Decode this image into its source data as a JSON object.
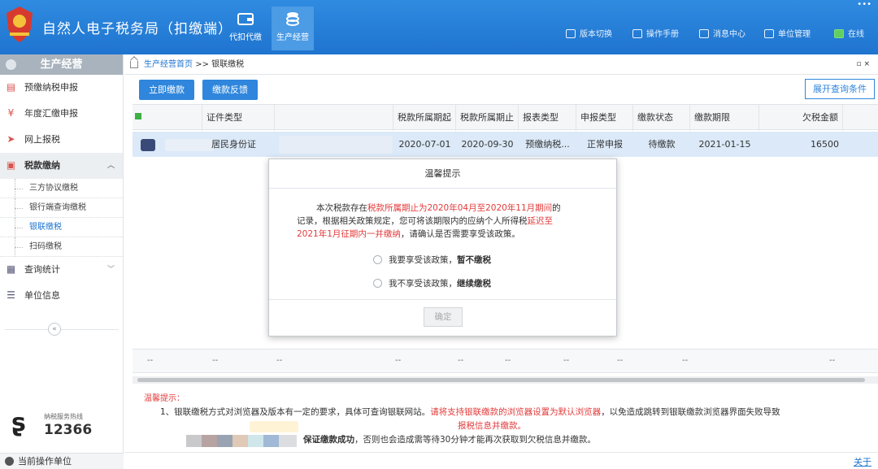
{
  "header": {
    "title": "自然人电子税务局（扣缴端）",
    "nav": [
      {
        "label": "代扣代缴",
        "icon": "wallet-icon"
      },
      {
        "label": "生产经营",
        "icon": "coins-icon"
      }
    ],
    "links": [
      "版本切换",
      "操作手册",
      "消息中心",
      "单位管理",
      "在线"
    ]
  },
  "sidebar": {
    "title": "生产经营",
    "items": [
      {
        "label": "预缴纳税申报",
        "icon": "document-icon"
      },
      {
        "label": "年度汇缴申报",
        "icon": "yen-icon"
      },
      {
        "label": "网上报税",
        "icon": "send-icon"
      },
      {
        "label": "税款缴纳",
        "icon": "tax-icon"
      }
    ],
    "subitems": [
      "三方协议缴税",
      "银行端查询缴税",
      "银联缴税",
      "扫码缴税"
    ],
    "items2": [
      {
        "label": "查询统计",
        "icon": "query-icon"
      },
      {
        "label": "单位信息",
        "icon": "list-icon"
      }
    ],
    "collapse": "«",
    "hotline_label": "纳税服务热线",
    "hotline_number": "12366",
    "footer": "当前操作单位"
  },
  "breadcrumb": {
    "home": "生产经营首页",
    "sep": ">>",
    "current": "银联缴税",
    "close": "▫ ×"
  },
  "toolbar": {
    "pay_now": "立即缴款",
    "feedback": "缴款反馈",
    "expand": "展开查询条件"
  },
  "table": {
    "columns": [
      "证件类型",
      "税款所属期起",
      "税款所属期止",
      "报表类型",
      "申报类型",
      "缴款状态",
      "缴款期限",
      "欠税金额"
    ],
    "row": {
      "id_type": "居民身份证",
      "period_start": "2020-07-01",
      "period_end": "2020-09-30",
      "report_type": "预缴纳税...",
      "declare_type": "正常申报",
      "pay_status": "待缴款",
      "deadline": "2021-01-15",
      "amount": "16500"
    },
    "placeholder": "--"
  },
  "modal": {
    "title": "温馨提示",
    "p1": "本次税款存在",
    "p1_red": "税款所属期止为2020年04月至2020年11月期间",
    "p1_end": "的",
    "p2": "记录，根据相关政策规定，您可将该期限内的应纳个人所得税",
    "p2_red": "延迟至",
    "p3_red": "2021年1月征期内一并缴纳",
    "p3": "，请确认是否需要享受该政策。",
    "opt1": "我要享受该政策，",
    "opt1_bold": "暂不缴税",
    "opt2": "我不享受该政策，",
    "opt2_bold": "继续缴税",
    "confirm": "确定"
  },
  "tips": {
    "title": "温馨提示：",
    "l1a": "1、银联缴税方式对浏览器及版本有一定的要求，具体可查询银联网站。",
    "l1_red": "请将支持银联缴款的浏览器设置为默认浏览器",
    "l1b": "，以免造成跳转到银联缴款浏览器界面失败导致",
    "l2_red": "报税信息并缴款。",
    "l3_bold": "保证缴款成功",
    "l3": "，否则也会造成需等待30分钟才能再次获取到欠税信息并缴款。"
  },
  "about": "关于"
}
